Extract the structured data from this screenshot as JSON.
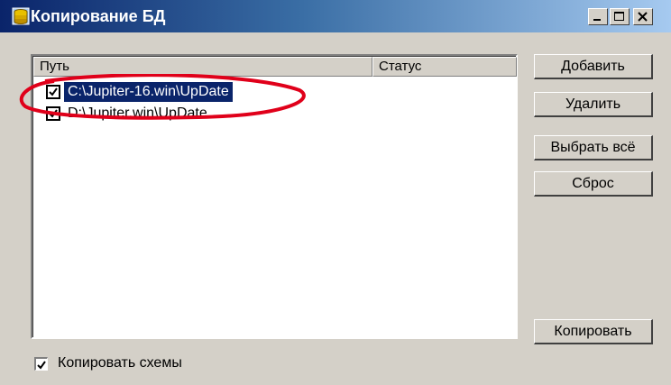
{
  "window": {
    "title": "Копирование БД",
    "controls": {
      "minimize": "_",
      "maximize": "□",
      "close": "X"
    }
  },
  "list": {
    "columns": [
      "Путь",
      "Статус"
    ],
    "items": [
      {
        "path": "C:\\Jupiter-16.win\\UpDate",
        "checked": true,
        "selected": true
      },
      {
        "path": "D:\\Jupiter.win\\UpDate",
        "checked": true,
        "selected": false
      }
    ]
  },
  "buttons": {
    "add": "Добавить",
    "delete": "Удалить",
    "select_all": "Выбрать всё",
    "reset": "Сброс",
    "copy": "Копировать"
  },
  "options": {
    "copy_schemes": {
      "label": "Копировать схемы",
      "checked": true
    }
  },
  "annotation": {
    "color": "#e0001a",
    "shape": "ellipse"
  },
  "colors": {
    "selection": "#0a246a",
    "face": "#d4d0c8"
  }
}
